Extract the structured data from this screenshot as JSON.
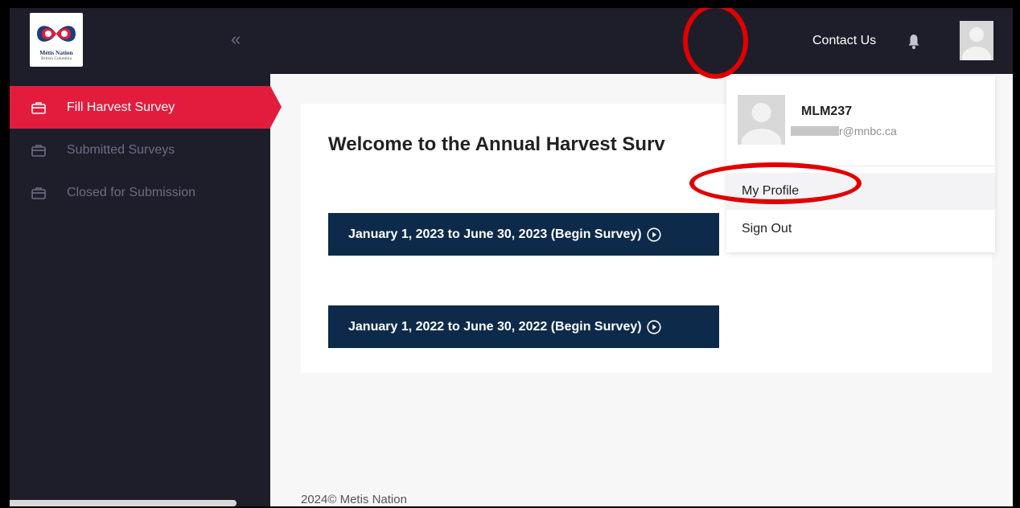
{
  "logo": {
    "title": "Métis Nation",
    "subtitle": "British Columbia",
    "collapse_glyph": "«"
  },
  "sidebar": {
    "items": [
      {
        "label": "Fill Harvest Survey",
        "icon": "briefcase-icon",
        "active": true
      },
      {
        "label": "Submitted Surveys",
        "icon": "briefcase-icon",
        "active": false
      },
      {
        "label": "Closed for Submission",
        "icon": "briefcase-icon",
        "active": false
      }
    ]
  },
  "topbar": {
    "contact_label": "Contact Us",
    "bell_icon": "bell-icon",
    "avatar_icon": "user-avatar-icon"
  },
  "main": {
    "welcome": "Welcome to the Annual Harvest Surv",
    "surveys": [
      {
        "label": "January 1, 2023 to June 30, 2023 (Begin Survey)"
      },
      {
        "label": "January 1, 2022 to June 30, 2022 (Begin Survey)"
      }
    ]
  },
  "dropdown": {
    "username": "MLM237",
    "email_visible": "r@mnbc.ca",
    "items": [
      {
        "label": "My Profile"
      },
      {
        "label": "Sign Out"
      }
    ]
  },
  "footer": {
    "text": "2024© Metis Nation"
  },
  "colors": {
    "sidebar_bg": "#1e1e2b",
    "active_red": "#e31c3d",
    "button_navy": "#0d2a4a",
    "annotation_red": "#e00000"
  }
}
